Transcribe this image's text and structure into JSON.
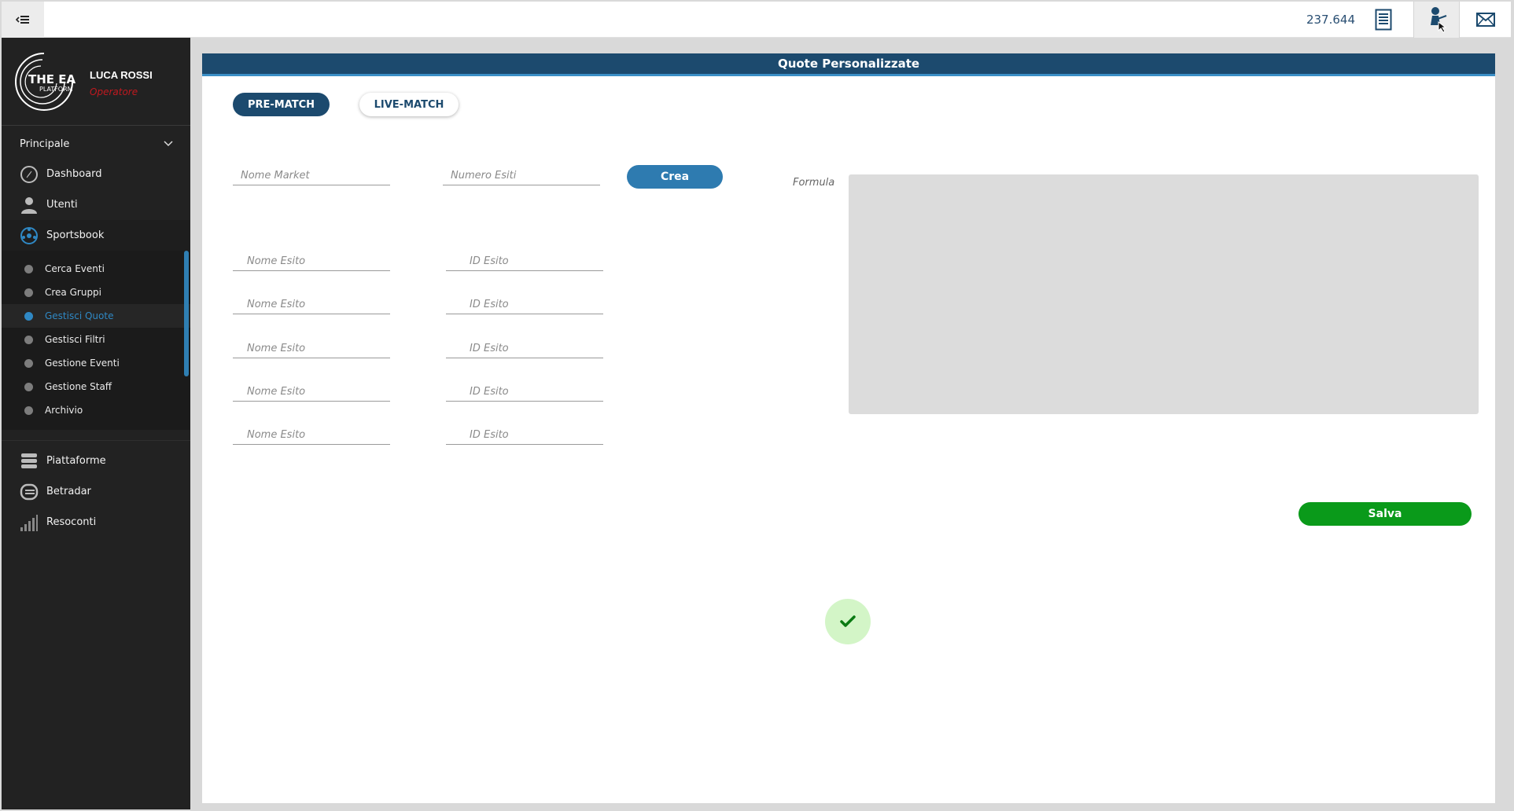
{
  "topbar": {
    "balance": "237.644",
    "icons": [
      "menu-collapse-icon",
      "receipt-icon",
      "user-pointer-icon",
      "mail-icon"
    ]
  },
  "sidebar": {
    "user_name": "LUCA ROSSI",
    "user_role": "Operatore",
    "logo_text": "THE EAR PLATFORM",
    "section_title": "Principale",
    "items": [
      {
        "label": "Dashboard",
        "icon": "compass-icon"
      },
      {
        "label": "Utenti",
        "icon": "user-icon"
      },
      {
        "label": "Sportsbook",
        "icon": "soccer-ball-icon"
      }
    ],
    "subitems": [
      {
        "label": "Cerca Eventi"
      },
      {
        "label": "Crea Gruppi"
      },
      {
        "label": "Gestisci Quote",
        "active": true
      },
      {
        "label": "Gestisci Filtri"
      },
      {
        "label": "Gestione Eventi"
      },
      {
        "label": "Gestione Staff"
      },
      {
        "label": "Archivio"
      }
    ],
    "bottom_items": [
      {
        "label": "Piattaforme",
        "icon": "platforms-icon"
      },
      {
        "label": "Betradar",
        "icon": "betradar-icon"
      },
      {
        "label": "Resoconti",
        "icon": "bar-chart-icon"
      }
    ]
  },
  "main": {
    "title": "Quote Personalizzate",
    "tabs": [
      {
        "label": "PRE-MATCH",
        "active": true
      },
      {
        "label": "LIVE-MATCH",
        "active": false
      }
    ],
    "market_name_placeholder": "Nome Market",
    "outcome_count_placeholder": "Numero Esiti",
    "create_button": "Crea",
    "outcome_name_placeholder": "Nome Esito",
    "outcome_id_placeholder": "ID Esito",
    "formula_label": "Formula",
    "save_button": "Salva"
  },
  "colors": {
    "header": "#1c4a6e",
    "accent": "#2e7bb0",
    "save": "#0a9a1a",
    "role": "#c0191f",
    "sidebar_bg": "#222222"
  }
}
